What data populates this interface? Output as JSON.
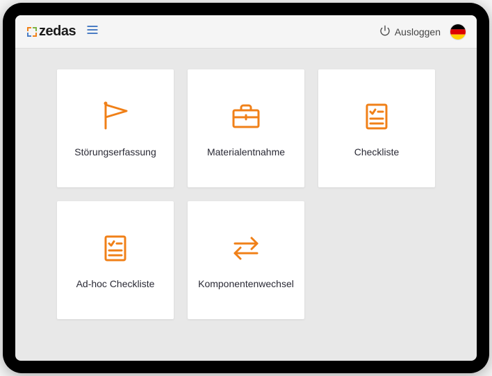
{
  "brand": {
    "name": "zedas"
  },
  "header": {
    "logout_label": "Ausloggen",
    "language": "de"
  },
  "tiles": [
    {
      "icon": "flag-icon",
      "label": "Störungserfassung"
    },
    {
      "icon": "briefcase-icon",
      "label": "Materialentnahme"
    },
    {
      "icon": "checklist-icon",
      "label": "Checkliste"
    },
    {
      "icon": "checklist-icon",
      "label": "Ad-hoc Checkliste"
    },
    {
      "icon": "swap-icon",
      "label": "Komponentenwechsel"
    }
  ],
  "colors": {
    "accent": "#f08018",
    "text": "#2a2a35",
    "link": "#4a7cc4"
  }
}
